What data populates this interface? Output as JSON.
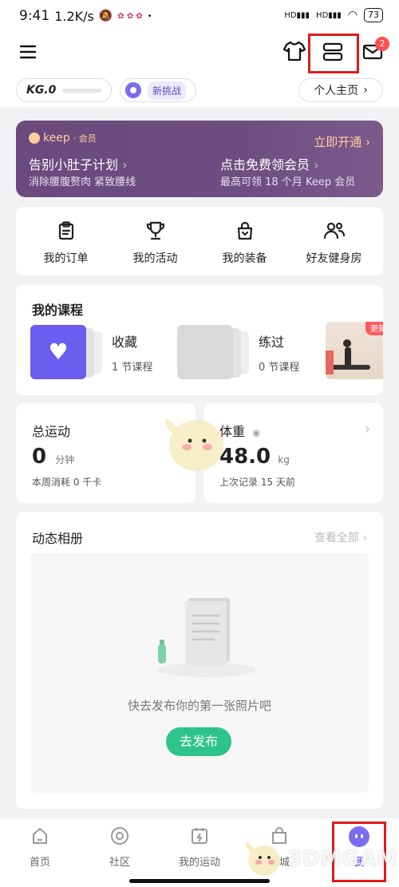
{
  "status": {
    "time": "9:41",
    "speed": "1.2K/s",
    "battery": "73"
  },
  "top_bar": {
    "badge_count": "2"
  },
  "level": {
    "label": "KG.0",
    "challenge_label": "新挑战",
    "homepage_label": "个人主页"
  },
  "vip": {
    "brand": "keep",
    "brand_suffix": "· 会员",
    "open_now": "立即开通",
    "plan_title": "告别小肚子计划",
    "plan_sub": "消除腰腹赘肉 紧致腰线",
    "free_title": "点击免费领会员",
    "free_sub": "最高可领 18 个月 Keep 会员"
  },
  "shortcuts": [
    {
      "label": "我的订单",
      "icon": "clipboard-icon"
    },
    {
      "label": "我的活动",
      "icon": "trophy-icon"
    },
    {
      "label": "我的装备",
      "icon": "bag-icon"
    },
    {
      "label": "好友健身房",
      "icon": "friends-icon"
    }
  ],
  "courses": {
    "title": "我的课程",
    "collect_label": "收藏",
    "collect_count": "1 节课程",
    "practiced_label": "练过",
    "practiced_count": "0 节课程",
    "update_tag": "更新"
  },
  "stats": {
    "total_title": "总运动",
    "total_value": "0",
    "total_unit": "分钟",
    "total_sub": "本周消耗 0 千卡",
    "weight_title": "体重",
    "weight_value": "48.0",
    "weight_unit": "kg",
    "weight_sub": "上次记录 15 天前"
  },
  "album": {
    "title": "动态相册",
    "view_all": "查看全部",
    "empty_text": "快去发布你的第一张照片吧",
    "publish_button": "去发布"
  },
  "tabs": [
    {
      "label": "首页",
      "icon": "home-icon"
    },
    {
      "label": "社区",
      "icon": "community-icon"
    },
    {
      "label": "我的运动",
      "icon": "calendar-icon"
    },
    {
      "label": "商城",
      "icon": "shop-icon"
    },
    {
      "label": "我",
      "icon": "me-icon"
    }
  ],
  "watermark": "3DMGAME",
  "colors": {
    "accent_green": "#2ec38a",
    "vip_purple": "#6b4a7e",
    "highlight_red": "#e01b1b",
    "me_purple": "#7a6cf0"
  }
}
